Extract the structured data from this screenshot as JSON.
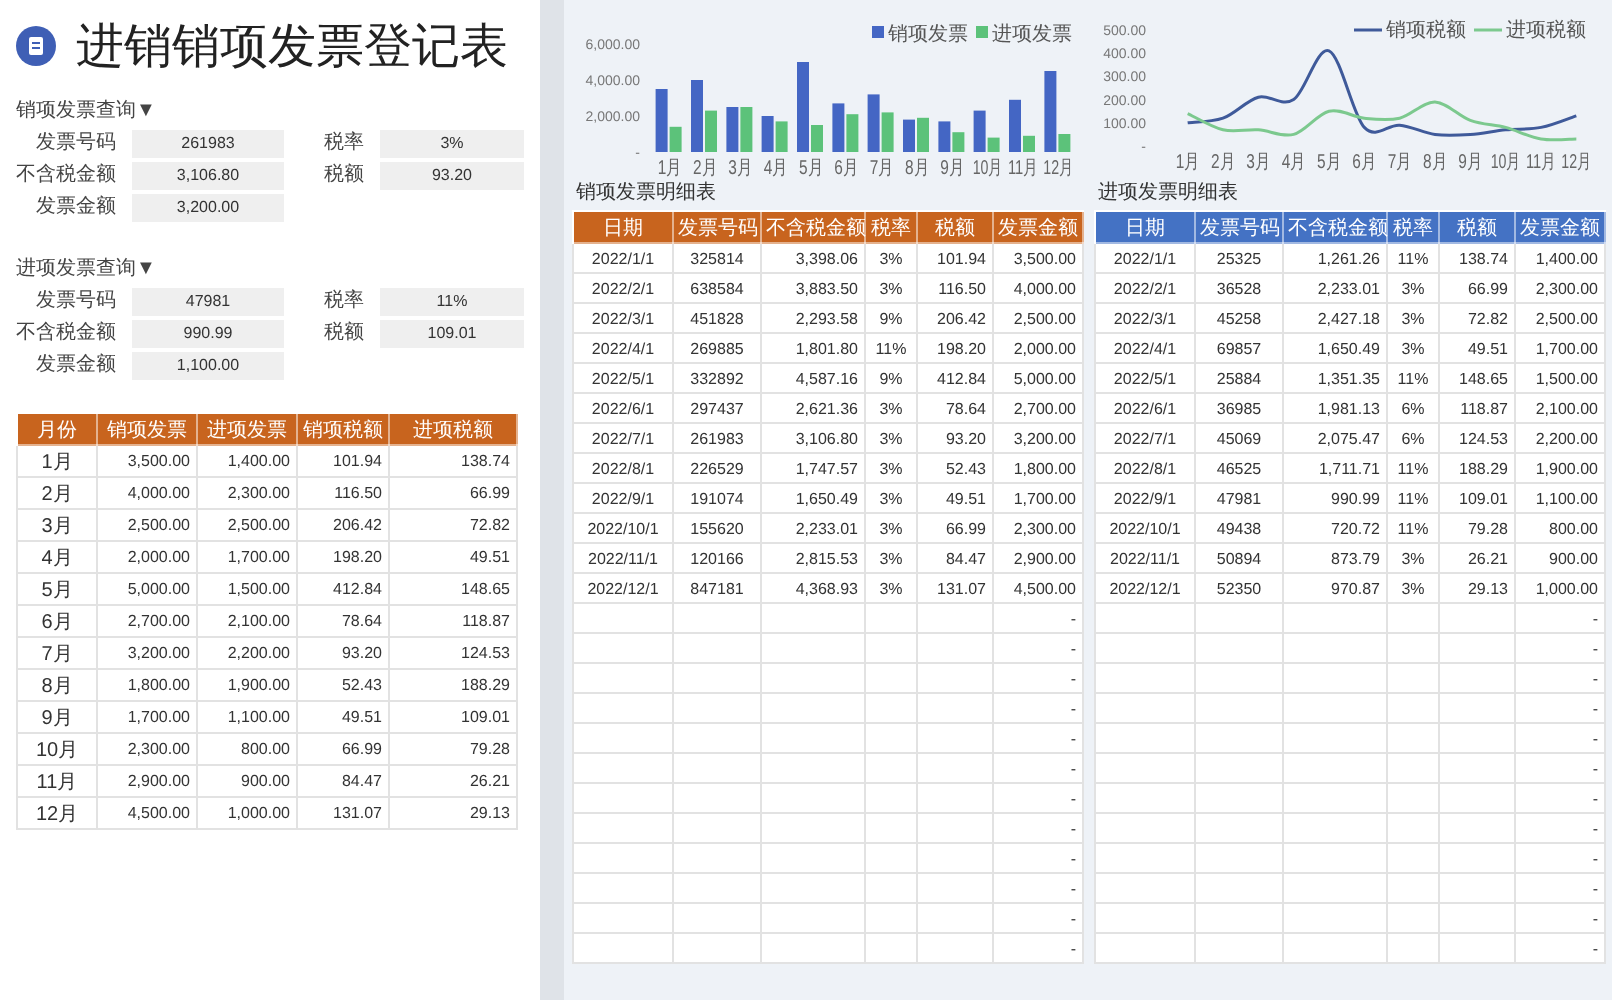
{
  "title": "进销销项发票登记表",
  "sales_query": {
    "label": "销项发票查询▼",
    "fields": [
      {
        "label": "发票号码",
        "value": "261983"
      },
      {
        "label": "税率",
        "value": "3%"
      },
      {
        "label": "不含税金额",
        "value": "3,106.80"
      },
      {
        "label": "税额",
        "value": "93.20"
      },
      {
        "label": "发票金额",
        "value": "3,200.00"
      }
    ]
  },
  "purchase_query": {
    "label": "进项发票查询▼",
    "fields": [
      {
        "label": "发票号码",
        "value": "47981"
      },
      {
        "label": "税率",
        "value": "11%"
      },
      {
        "label": "不含税金额",
        "value": "990.99"
      },
      {
        "label": "税额",
        "value": "109.01"
      },
      {
        "label": "发票金额",
        "value": "1,100.00"
      }
    ]
  },
  "summary_table": {
    "columns": [
      "月份",
      "销项发票",
      "进项发票",
      "销项税额",
      "进项税额"
    ],
    "rows": [
      [
        "1月",
        "3,500.00",
        "1,400.00",
        "101.94",
        "138.74"
      ],
      [
        "2月",
        "4,000.00",
        "2,300.00",
        "116.50",
        "66.99"
      ],
      [
        "3月",
        "2,500.00",
        "2,500.00",
        "206.42",
        "72.82"
      ],
      [
        "4月",
        "2,000.00",
        "1,700.00",
        "198.20",
        "49.51"
      ],
      [
        "5月",
        "5,000.00",
        "1,500.00",
        "412.84",
        "148.65"
      ],
      [
        "6月",
        "2,700.00",
        "2,100.00",
        "78.64",
        "118.87"
      ],
      [
        "7月",
        "3,200.00",
        "2,200.00",
        "93.20",
        "124.53"
      ],
      [
        "8月",
        "1,800.00",
        "1,900.00",
        "52.43",
        "188.29"
      ],
      [
        "9月",
        "1,700.00",
        "1,100.00",
        "49.51",
        "109.01"
      ],
      [
        "10月",
        "2,300.00",
        "800.00",
        "66.99",
        "79.28"
      ],
      [
        "11月",
        "2,900.00",
        "900.00",
        "84.47",
        "26.21"
      ],
      [
        "12月",
        "4,500.00",
        "1,000.00",
        "131.07",
        "29.13"
      ]
    ]
  },
  "invoice_chart": {
    "chart_data": {
      "type": "bar",
      "categories": [
        "1月",
        "2月",
        "3月",
        "4月",
        "5月",
        "6月",
        "7月",
        "8月",
        "9月",
        "10月",
        "11月",
        "12月"
      ],
      "series": [
        {
          "name": "销项发票",
          "color": "#4466c4",
          "values": [
            3500,
            4000,
            2500,
            2000,
            5000,
            2700,
            3200,
            1800,
            1700,
            2300,
            2900,
            4500
          ]
        },
        {
          "name": "进项发票",
          "color": "#5cc27a",
          "values": [
            1400,
            2300,
            2500,
            1700,
            1500,
            2100,
            2200,
            1900,
            1100,
            800,
            900,
            1000
          ]
        }
      ],
      "legend": true,
      "ylim": [
        0,
        6000
      ],
      "yticks": [
        {
          "value": 0,
          "label": "-"
        },
        {
          "value": 2000,
          "label": "2,000.00"
        },
        {
          "value": 4000,
          "label": "4,000.00"
        },
        {
          "value": 6000,
          "label": "6,000.00"
        }
      ]
    }
  },
  "tax_chart": {
    "chart_data": {
      "type": "line",
      "categories": [
        "1月",
        "2月",
        "3月",
        "4月",
        "5月",
        "6月",
        "7月",
        "8月",
        "9月",
        "10月",
        "11月",
        "12月"
      ],
      "series": [
        {
          "name": "销项税额",
          "color": "#3f5a9a",
          "values": [
            100,
            120,
            210,
            200,
            410,
            80,
            90,
            50,
            50,
            70,
            80,
            130
          ]
        },
        {
          "name": "进项税额",
          "color": "#7cc98e",
          "values": [
            140,
            70,
            70,
            50,
            150,
            120,
            120,
            190,
            110,
            80,
            30,
            30
          ]
        }
      ],
      "legend": true,
      "ylim": [
        0,
        500
      ],
      "yticks": [
        {
          "value": 0,
          "label": "-"
        },
        {
          "value": 100,
          "label": "100.00"
        },
        {
          "value": 200,
          "label": "200.00"
        },
        {
          "value": 300,
          "label": "300.00"
        },
        {
          "value": 400,
          "label": "400.00"
        },
        {
          "value": 500,
          "label": "500.00"
        }
      ]
    }
  },
  "sales_detail": {
    "title": "销项发票明细表",
    "columns": [
      "日期",
      "发票号码",
      "不含税金额",
      "税率",
      "税额",
      "发票金额"
    ],
    "rows": [
      [
        "2022/1/1",
        "325814",
        "3,398.06",
        "3%",
        "101.94",
        "3,500.00"
      ],
      [
        "2022/2/1",
        "638584",
        "3,883.50",
        "3%",
        "116.50",
        "4,000.00"
      ],
      [
        "2022/3/1",
        "451828",
        "2,293.58",
        "9%",
        "206.42",
        "2,500.00"
      ],
      [
        "2022/4/1",
        "269885",
        "1,801.80",
        "11%",
        "198.20",
        "2,000.00"
      ],
      [
        "2022/5/1",
        "332892",
        "4,587.16",
        "9%",
        "412.84",
        "5,000.00"
      ],
      [
        "2022/6/1",
        "297437",
        "2,621.36",
        "3%",
        "78.64",
        "2,700.00"
      ],
      [
        "2022/7/1",
        "261983",
        "3,106.80",
        "3%",
        "93.20",
        "3,200.00"
      ],
      [
        "2022/8/1",
        "226529",
        "1,747.57",
        "3%",
        "52.43",
        "1,800.00"
      ],
      [
        "2022/9/1",
        "191074",
        "1,650.49",
        "3%",
        "49.51",
        "1,700.00"
      ],
      [
        "2022/10/1",
        "155620",
        "2,233.01",
        "3%",
        "66.99",
        "2,300.00"
      ],
      [
        "2022/11/1",
        "120166",
        "2,815.53",
        "3%",
        "84.47",
        "2,900.00"
      ],
      [
        "2022/12/1",
        "847181",
        "4,368.93",
        "3%",
        "131.07",
        "4,500.00"
      ]
    ],
    "blank_rows": [
      "-",
      "-",
      "-",
      "-",
      "-",
      "-",
      "-",
      "-",
      "-",
      "-",
      "-",
      "-"
    ]
  },
  "purchase_detail": {
    "title": "进项发票明细表",
    "columns": [
      "日期",
      "发票号码",
      "不含税金额",
      "税率",
      "税额",
      "发票金额"
    ],
    "rows": [
      [
        "2022/1/1",
        "25325",
        "1,261.26",
        "11%",
        "138.74",
        "1,400.00"
      ],
      [
        "2022/2/1",
        "36528",
        "2,233.01",
        "3%",
        "66.99",
        "2,300.00"
      ],
      [
        "2022/3/1",
        "45258",
        "2,427.18",
        "3%",
        "72.82",
        "2,500.00"
      ],
      [
        "2022/4/1",
        "69857",
        "1,650.49",
        "3%",
        "49.51",
        "1,700.00"
      ],
      [
        "2022/5/1",
        "25884",
        "1,351.35",
        "11%",
        "148.65",
        "1,500.00"
      ],
      [
        "2022/6/1",
        "36985",
        "1,981.13",
        "6%",
        "118.87",
        "2,100.00"
      ],
      [
        "2022/7/1",
        "45069",
        "2,075.47",
        "6%",
        "124.53",
        "2,200.00"
      ],
      [
        "2022/8/1",
        "46525",
        "1,711.71",
        "11%",
        "188.29",
        "1,900.00"
      ],
      [
        "2022/9/1",
        "47981",
        "990.99",
        "11%",
        "109.01",
        "1,100.00"
      ],
      [
        "2022/10/1",
        "49438",
        "720.72",
        "11%",
        "79.28",
        "800.00"
      ],
      [
        "2022/11/1",
        "50894",
        "873.79",
        "3%",
        "26.21",
        "900.00"
      ],
      [
        "2022/12/1",
        "52350",
        "970.87",
        "3%",
        "29.13",
        "1,000.00"
      ]
    ],
    "blank_rows": [
      "-",
      "-",
      "-",
      "-",
      "-",
      "-",
      "-",
      "-",
      "-",
      "-",
      "-",
      "-"
    ]
  }
}
